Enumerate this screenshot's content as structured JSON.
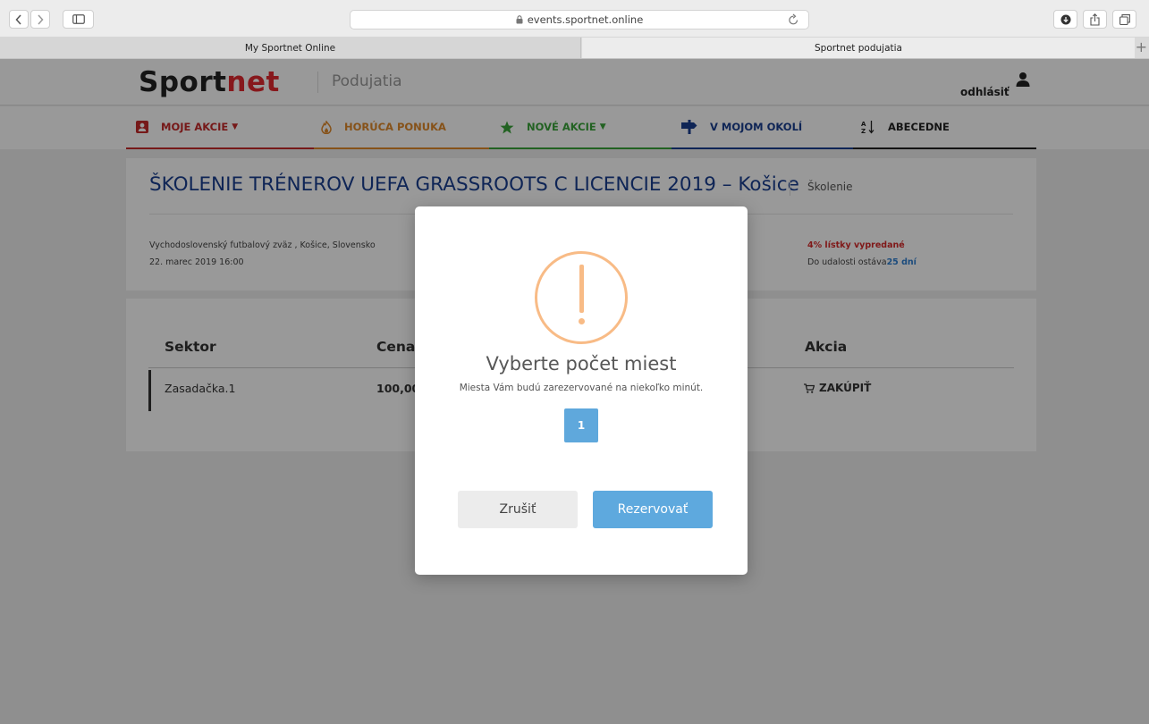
{
  "browser": {
    "url": "events.sportnet.online",
    "tabs": [
      {
        "label": "My Sportnet Online"
      },
      {
        "label": "Sportnet podujatia"
      }
    ]
  },
  "header": {
    "logo_part1": "Sport",
    "logo_part2": "net",
    "subtitle": "Podujatia",
    "logout": "odhlásiť"
  },
  "nav": {
    "items": [
      {
        "label": "MOJE AKCIE",
        "color": "#c52a2a"
      },
      {
        "label": "HORÚCA PONUKA",
        "color": "#e0892a"
      },
      {
        "label": "NOVÉ AKCIE",
        "color": "#3aa33a"
      },
      {
        "label": "V MOJOM OKOLÍ",
        "color": "#1a3f8f"
      },
      {
        "label": "ABECEDNE",
        "color": "#222222"
      }
    ]
  },
  "event": {
    "title": "ŠKOLENIE TRÉNEROV UEFA GRASSROOTS C LICENCIE 2019 – Košice",
    "type": "Školenie",
    "venue": "Vychodoslovenský futbalový zväz , Košice, Slovensko",
    "date": "22. marec 2019 16:00",
    "sold": "4% lístky vypredané",
    "remaining_prefix": "Do udalosti ostáva",
    "remaining_days": "25 dní"
  },
  "table": {
    "headers": {
      "sector": "Sektor",
      "price": "Cena",
      "action": "Akcia"
    },
    "rows": [
      {
        "sector": "Zasadačka.1",
        "price": "100,00",
        "action": "ZAKÚPIŤ"
      }
    ]
  },
  "modal": {
    "title": "Vyberte počet miest",
    "text": "Miesta Vám budú zarezervované na niekoľko minút.",
    "quantity": "1",
    "cancel": "Zrušiť",
    "confirm": "Rezervovať",
    "icon_color": "#f8bb86",
    "confirm_color": "#5ea9de"
  }
}
